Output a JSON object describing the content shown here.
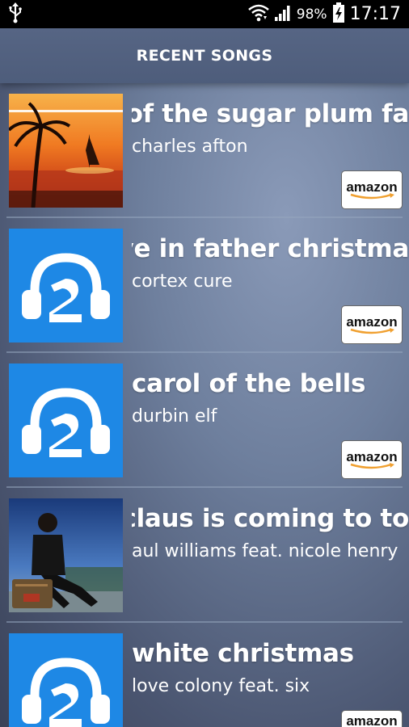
{
  "status_bar": {
    "usb_icon": "usb-icon",
    "wifi_icon": "wifi-icon",
    "signal_icon": "signal-icon",
    "battery_percent": "98%",
    "battery_icon": "battery-charging-icon",
    "time": "17:17"
  },
  "header": {
    "title": "RECENT SONGS"
  },
  "songs": [
    {
      "title": "ce of the sugar plum fa",
      "artist": "charles afton",
      "buy_label": "amazon",
      "cover": "lost-sunset-lounge-cover"
    },
    {
      "title": "ieve in father christma",
      "artist": "cortex cure",
      "buy_label": "amazon",
      "cover": "default-headphones-cover"
    },
    {
      "title": "carol of the bells",
      "artist": "durbin elf",
      "buy_label": "amazon",
      "cover": "default-headphones-cover"
    },
    {
      "title": "a claus is coming to to",
      "artist": "aul williams feat. nicole henry",
      "buy_label": "amazon",
      "cover": "man-on-suitcase-cover"
    },
    {
      "title": "white christmas",
      "artist": "love colony feat. six",
      "buy_label": "amazon",
      "cover": "default-headphones-cover"
    }
  ],
  "colors": {
    "header_bg": "#566584",
    "accent_blue": "#1e88e5",
    "text": "#ffffff"
  }
}
